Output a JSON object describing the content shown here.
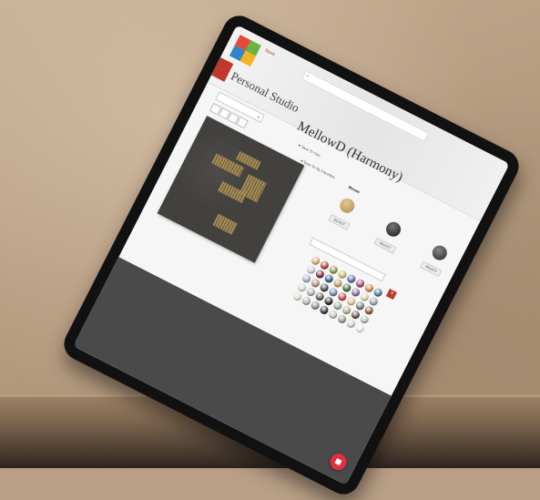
{
  "scene": {
    "background_colors": {
      "wall": "#b89f86",
      "shelf": "#7e6650"
    }
  },
  "tablet": {
    "screen": {
      "header": {
        "top_link": "Store",
        "search_placeholder": "",
        "ribbon": "",
        "studio_title": "Personal Studio",
        "product_title": "MellowD (Harmony)",
        "links": [
          "",
          ""
        ]
      },
      "toolbar": {
        "dropdown_value": "",
        "action_1": "Save To Cart",
        "action_2": "Save To My Favorites"
      },
      "tabs": [
        "",
        "Mosaic",
        "",
        ""
      ],
      "size_select": "",
      "swatches": [
        {
          "label": "",
          "color": "#c8a874"
        },
        {
          "label": "",
          "color": "#2b2b2b"
        },
        {
          "label": "",
          "color": "#3a3a3a"
        }
      ],
      "select_labels": [
        "SELECT",
        "SELECT",
        "SELECT"
      ],
      "color_search_placeholder": "",
      "color_panel": {
        "title": "",
        "close": "×",
        "colors": [
          "#d8b07a",
          "#b0463f",
          "#8e9a53",
          "#c9c06a",
          "#5f6fa0",
          "#a34b6c",
          "#d28b52",
          "#4d7f9a",
          "#cfd2d6",
          "#7b2d3f",
          "#2e5d8e",
          "#c7a15a",
          "#3f6d43",
          "#8b6aa8",
          "#e0d4b8",
          "#9aa2aa",
          "#a6b6c8",
          "#b98a7a",
          "#4a4a4a",
          "#6a8ab0",
          "#c64a4a",
          "#e1c7a0",
          "#777",
          "#8c5c3a",
          "#dcdcdc",
          "#b2b2b2",
          "#5d5d5d",
          "#2a2a2a",
          "#9cb0a0",
          "#b8b091",
          "#655448",
          "#c0c0c0",
          "#e6e0d4",
          "#bbb4a8",
          "#8e8e8e",
          "#3d3d3d",
          "#c8c2b6",
          "#a39b8f",
          "#d0d0d0",
          "#f0f0f0"
        ]
      },
      "footer": {
        "col1_heading": "",
        "col1_lines": [
          "",
          "",
          "",
          "",
          ""
        ],
        "col2_heading": "",
        "col2_lines": [
          "",
          "",
          "",
          ""
        ]
      }
    }
  }
}
